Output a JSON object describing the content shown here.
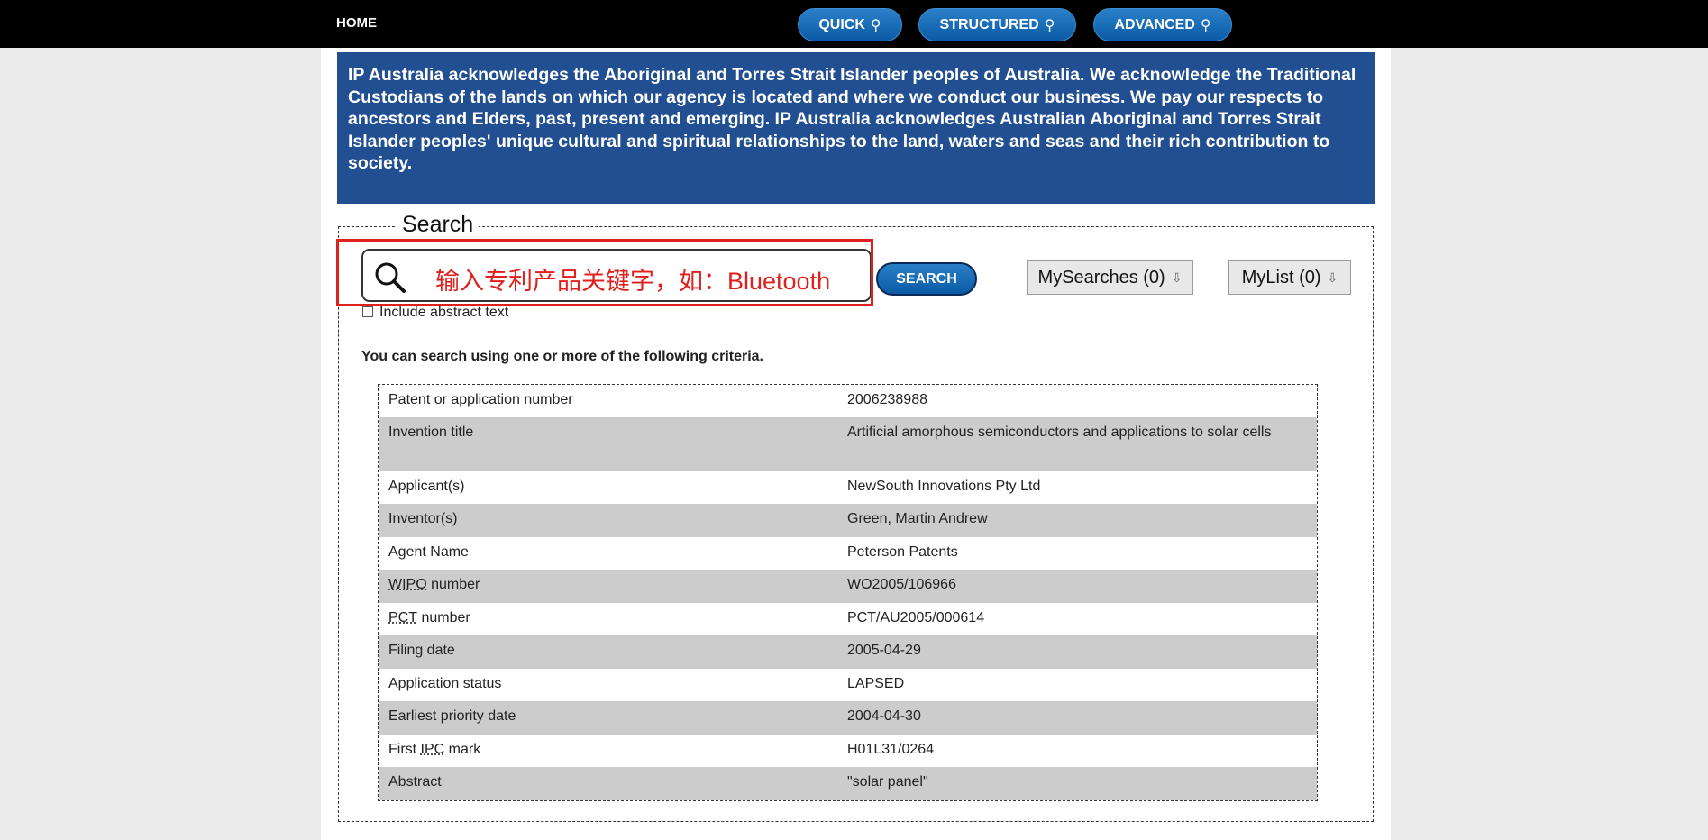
{
  "nav": {
    "home": "HOME",
    "quick": "QUICK",
    "structured": "STRUCTURED",
    "advanced": "ADVANCED"
  },
  "acknowledgement": "IP Australia acknowledges the Aboriginal and Torres Strait Islander peoples of Australia. We acknowledge the Traditional Custodians of the lands on which our agency is located and where we conduct our business. We pay our respects to ancestors and Elders, past, present and emerging. IP Australia acknowledges Australian Aboriginal and Torres Strait Islander peoples' unique cultural and spiritual relationships to the land, waters and seas and their rich contribution to society.",
  "search": {
    "legend": "Search",
    "overlay_text": "输入专利产品关键字，如：Bluetooth",
    "button": "SEARCH",
    "my_searches": "MySearches (0)",
    "my_list": "MyList (0)",
    "include_abstract": "Include abstract text",
    "criteria_intro": "You can search using one or more of the following criteria."
  },
  "criteria": [
    {
      "label": "Patent or application number",
      "value": "2006238988"
    },
    {
      "label": "Invention title",
      "value": "Artificial amorphous semiconductors and applications to solar cells"
    },
    {
      "label": "Applicant(s)",
      "value": "NewSouth Innovations Pty Ltd"
    },
    {
      "label": "Inventor(s)",
      "value": "Green, Martin Andrew"
    },
    {
      "label": "Agent Name",
      "value": "Peterson Patents"
    },
    {
      "label_abbr": "WIPO",
      "label_rest": " number",
      "value": "WO2005/106966"
    },
    {
      "label_abbr": "PCT",
      "label_rest": " number",
      "value": "PCT/AU2005/000614"
    },
    {
      "label": "Filing date",
      "value": "2005-04-29"
    },
    {
      "label": "Application status",
      "value": "LAPSED"
    },
    {
      "label": "Earliest priority date",
      "value": "2004-04-30"
    },
    {
      "label_pre": "First ",
      "label_abbr": "IPC",
      "label_rest": " mark",
      "value": "H01L31/0264"
    },
    {
      "label": "Abstract",
      "value": "\"solar panel\""
    }
  ],
  "colors": {
    "banner": "#214f92",
    "pill": "#0b5aa6",
    "highlight": "#e0201c",
    "alt_row": "#cccccc"
  }
}
